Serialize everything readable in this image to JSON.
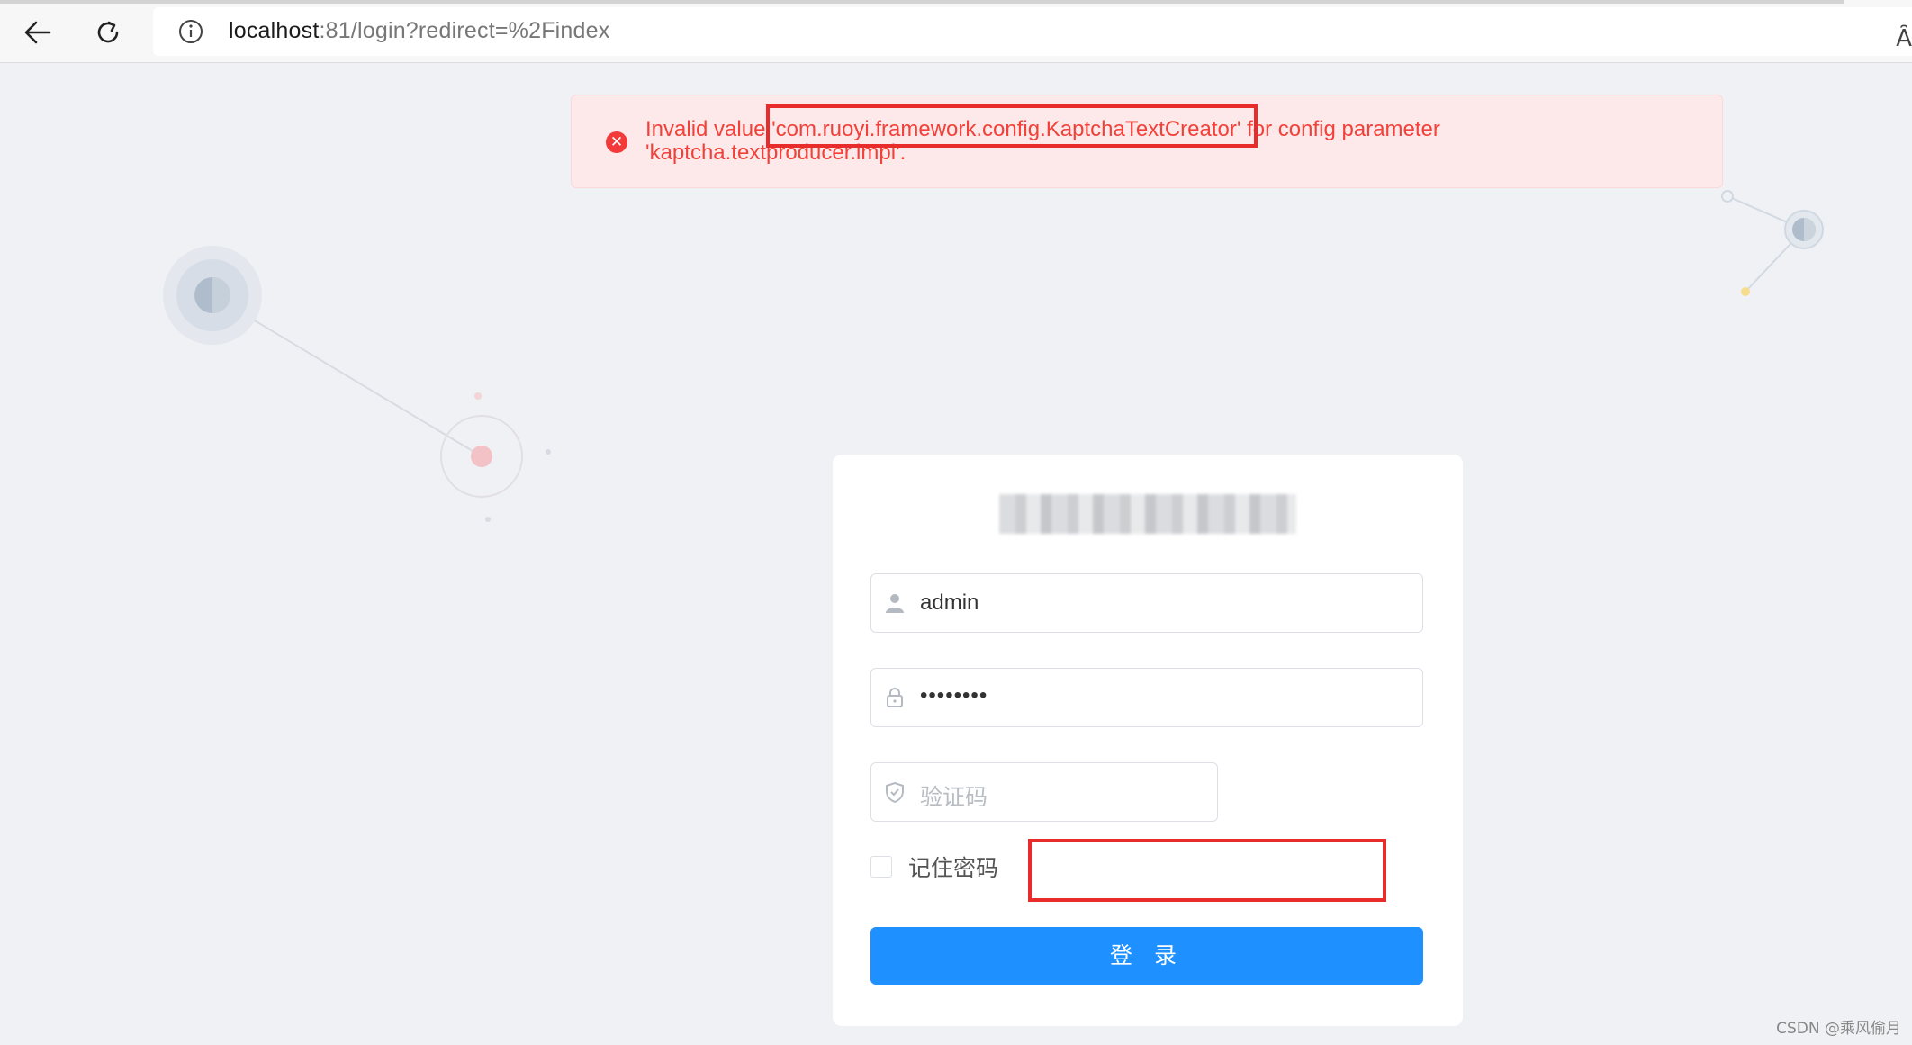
{
  "browser": {
    "url_host": "localhost",
    "url_rest": ":81/login?redirect=%2Findex",
    "reader_icon_text": "Ȃ"
  },
  "alert": {
    "icon": "close-circle-icon",
    "message": "Invalid value 'com.ruoyi.framework.config.KaptchaTextCreator' for config parameter 'kaptcha.textproducer.impl'.",
    "color": "#f2413a"
  },
  "login": {
    "username_value": "admin",
    "password_value": "••••••••",
    "captcha_placeholder": "验证码",
    "remember_label": "记住密码",
    "submit_label": "登 录",
    "accent_color": "#1e90ff"
  },
  "watermark": "CSDN @乘风偷月"
}
